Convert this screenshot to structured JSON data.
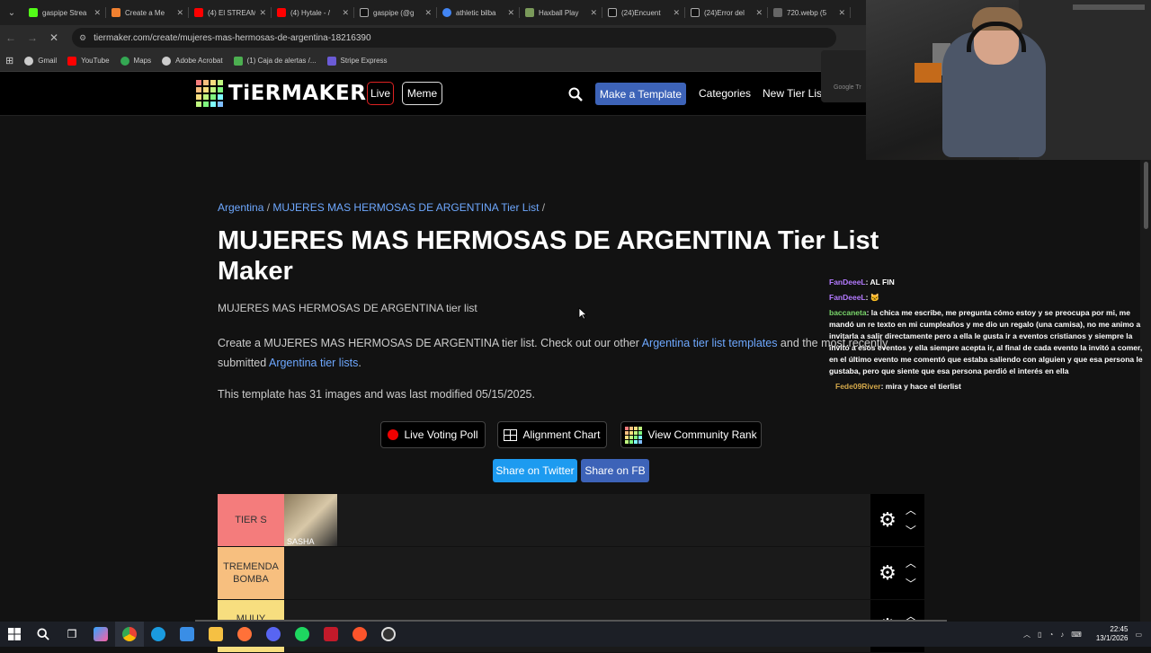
{
  "browser": {
    "tabs": [
      {
        "label": "gaspipe Strea",
        "color": "#53fc18"
      },
      {
        "label": "Create a Me",
        "color": "#f08030"
      },
      {
        "label": "(4) El STREAM",
        "color": "#ff0000"
      },
      {
        "label": "(4) Hytale - /",
        "color": "#ff0000"
      },
      {
        "label": "gaspipe (@g",
        "color": "#111111"
      },
      {
        "label": "athletic bilba",
        "color": "#4285f4"
      },
      {
        "label": "Haxball Play",
        "color": "#7a9a5a"
      },
      {
        "label": "(24)Encuent",
        "color": "#111111"
      },
      {
        "label": "(24)Error del",
        "color": "#111111"
      },
      {
        "label": "720.webp (5",
        "color": "#666666"
      }
    ],
    "close_glyph": "✕",
    "url": "tiermaker.com/create/mujeres-mas-hermosas-de-argentina-18216390",
    "bookmarks": [
      {
        "label": "Gmail",
        "color": "#cccccc"
      },
      {
        "label": "YouTube",
        "color": "#ff0000"
      },
      {
        "label": "Maps",
        "color": "#34a853"
      },
      {
        "label": "Adobe Acrobat",
        "color": "#cccccc"
      },
      {
        "label": "(1) Caja de alertas /...",
        "color": "#4caf50"
      },
      {
        "label": "Stripe Express",
        "color": "#6b5bd6"
      }
    ]
  },
  "site": {
    "logo_text": "TiERMAKER",
    "live_label": "Live",
    "meme_label": "Meme",
    "make_template_label": "Make a Template",
    "categories_label": "Categories",
    "new_tier_label": "New Tier Lis"
  },
  "page": {
    "breadcrumb_cat": "Argentina",
    "breadcrumb_sep": " / ",
    "breadcrumb_list": "MUJERES MAS HERMOSAS DE ARGENTINA Tier List",
    "breadcrumb_end": " /",
    "title": "MUJERES MAS HERMOSAS DE ARGENTINA Tier List Maker",
    "subtitle": "MUJERES MAS HERMOSAS DE ARGENTINA tier list",
    "desc_1": "Create a MUJERES MAS HERMOSAS DE ARGENTINA tier list. Check out our other ",
    "desc_link_1": "Argentina tier list templates",
    "desc_2": " and the most recently",
    "desc_3": "submitted ",
    "desc_link_2": "Argentina tier lists",
    "desc_4": ".",
    "meta": "This template has 31 images and was last modified 05/15/2025.",
    "live_voting_label": "Live Voting Poll",
    "alignment_label": "Alignment Chart",
    "community_label": "View Community Rank",
    "twitter_label": "Share on Twitter",
    "fb_label": "Share on FB"
  },
  "tiers": [
    {
      "label": "TIER S",
      "color": "#f47c7c",
      "image_caption": "SASHA"
    },
    {
      "label": "TREMENDA BOMBA",
      "color": "#f7bf7f",
      "image_caption": ""
    },
    {
      "label": "MUUY",
      "color": "#f7de7f",
      "image_caption": ""
    }
  ],
  "chat": [
    {
      "user": "FanDeeeL",
      "color": "#b47aff",
      "text": ": AL FIN"
    },
    {
      "user": "FanDeeeL",
      "color": "#b47aff",
      "text": ": 🐱"
    },
    {
      "user": "baccaneta",
      "color": "#7ad66b",
      "text": ": la chica me escribe, me pregunta cómo estoy y se preocupa por mi, me mandó un re texto en mi cumpleaños y me dio un regalo (una camisa), no me animo a invitarla a salir directamente pero a ella le gusta ir a eventos cristianos y siempre la invitó a esos eventos y ella siempre acepta ir, al final de cada evento la invitó a comer, en el último evento me comentó que estaba saliendo con alguien y que esa persona le gustaba, pero que siente que esa persona perdió el interés en ella"
    },
    {
      "user": "Fede09River",
      "color": "#d4a84a",
      "text": ": mira y hace el tierlist"
    }
  ],
  "popup_text": "Google Tr",
  "taskbar": {
    "time": "22:45",
    "date": "13/1/2026"
  }
}
